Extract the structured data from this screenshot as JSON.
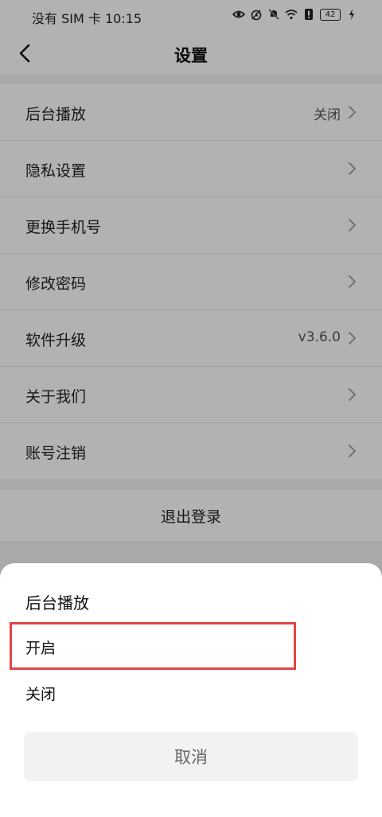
{
  "status_bar": {
    "carrier_time": "没有 SIM 卡 10:15",
    "battery": "42",
    "icons": [
      "eye-icon",
      "alarm-icon",
      "mute-icon",
      "wifi-icon",
      "alert-icon",
      "battery-icon",
      "charging-icon"
    ]
  },
  "nav": {
    "back_icon": "chevron-left-icon",
    "title": "设置"
  },
  "settings": {
    "items": [
      {
        "label": "后台播放",
        "value": "关闭"
      },
      {
        "label": "隐私设置",
        "value": ""
      },
      {
        "label": "更换手机号",
        "value": ""
      },
      {
        "label": "修改密码",
        "value": ""
      },
      {
        "label": "软件升级",
        "value": "v3.6.0"
      },
      {
        "label": "关于我们",
        "value": ""
      },
      {
        "label": "账号注销",
        "value": ""
      }
    ],
    "logout_label": "退出登录"
  },
  "sheet": {
    "title": "后台播放",
    "options": [
      "开启",
      "关闭"
    ],
    "highlight_color": "#e04545",
    "cancel_label": "取消"
  }
}
